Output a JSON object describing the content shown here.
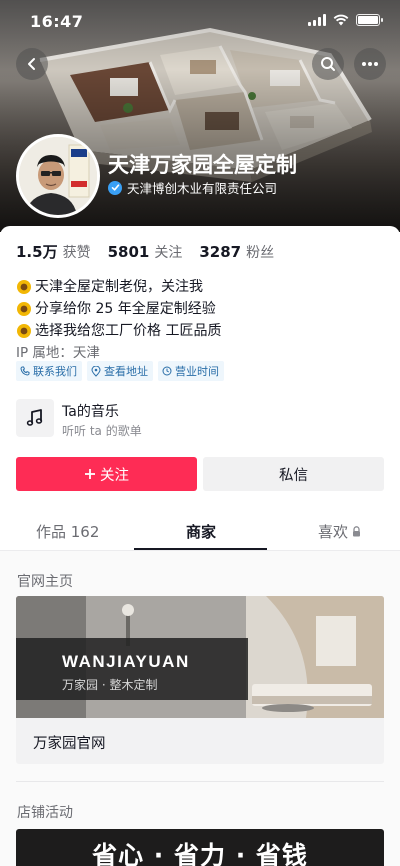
{
  "status_bar": {
    "time": "16:47",
    "battery_level": 1.0
  },
  "header": {
    "shop_name": "天津万家园全屋定制",
    "company": "天津博创木业有限责任公司",
    "avatar_badge": "万家园 · 老倪"
  },
  "stats": [
    {
      "value": "1.5万",
      "label": "获赞"
    },
    {
      "value": "5801",
      "label": "关注"
    },
    {
      "value": "3287",
      "label": "粉丝"
    }
  ],
  "bio": {
    "lines": [
      "天津全屋定制老倪，关注我",
      "分享给你 25 年全屋定制经验",
      "选择我给您工厂价格 工匠品质"
    ],
    "ip_location": "IP 属地：天津"
  },
  "chips": [
    {
      "label": "联系我们",
      "icon": "phone-icon"
    },
    {
      "label": "查看地址",
      "icon": "location-pin-icon"
    },
    {
      "label": "营业时间",
      "icon": "clock-icon"
    }
  ],
  "music": {
    "title": "Ta的音乐",
    "subtitle": "听听 ta 的歌单",
    "icon": "music-note-icon"
  },
  "actions": {
    "follow_label": "关注",
    "message_label": "私信"
  },
  "tabs": [
    {
      "label": "作品 162",
      "active": false
    },
    {
      "label": "商家",
      "active": true
    },
    {
      "label": "喜欢",
      "active": false,
      "locked": true
    }
  ],
  "sections": {
    "official_site_title": "官网主页",
    "official_card": {
      "brand": "WANJIAYUAN",
      "tagline": "万家园 · 整木定制",
      "label": "万家园官网"
    },
    "store_activity_title": "店铺活动",
    "promo_banner": "省心 · 省力 · 省钱"
  },
  "colors": {
    "accent": "#fe2c55",
    "verified": "#3aa0f5",
    "chip_text": "#2a6ea8",
    "chip_bg": "#eef6fc"
  }
}
